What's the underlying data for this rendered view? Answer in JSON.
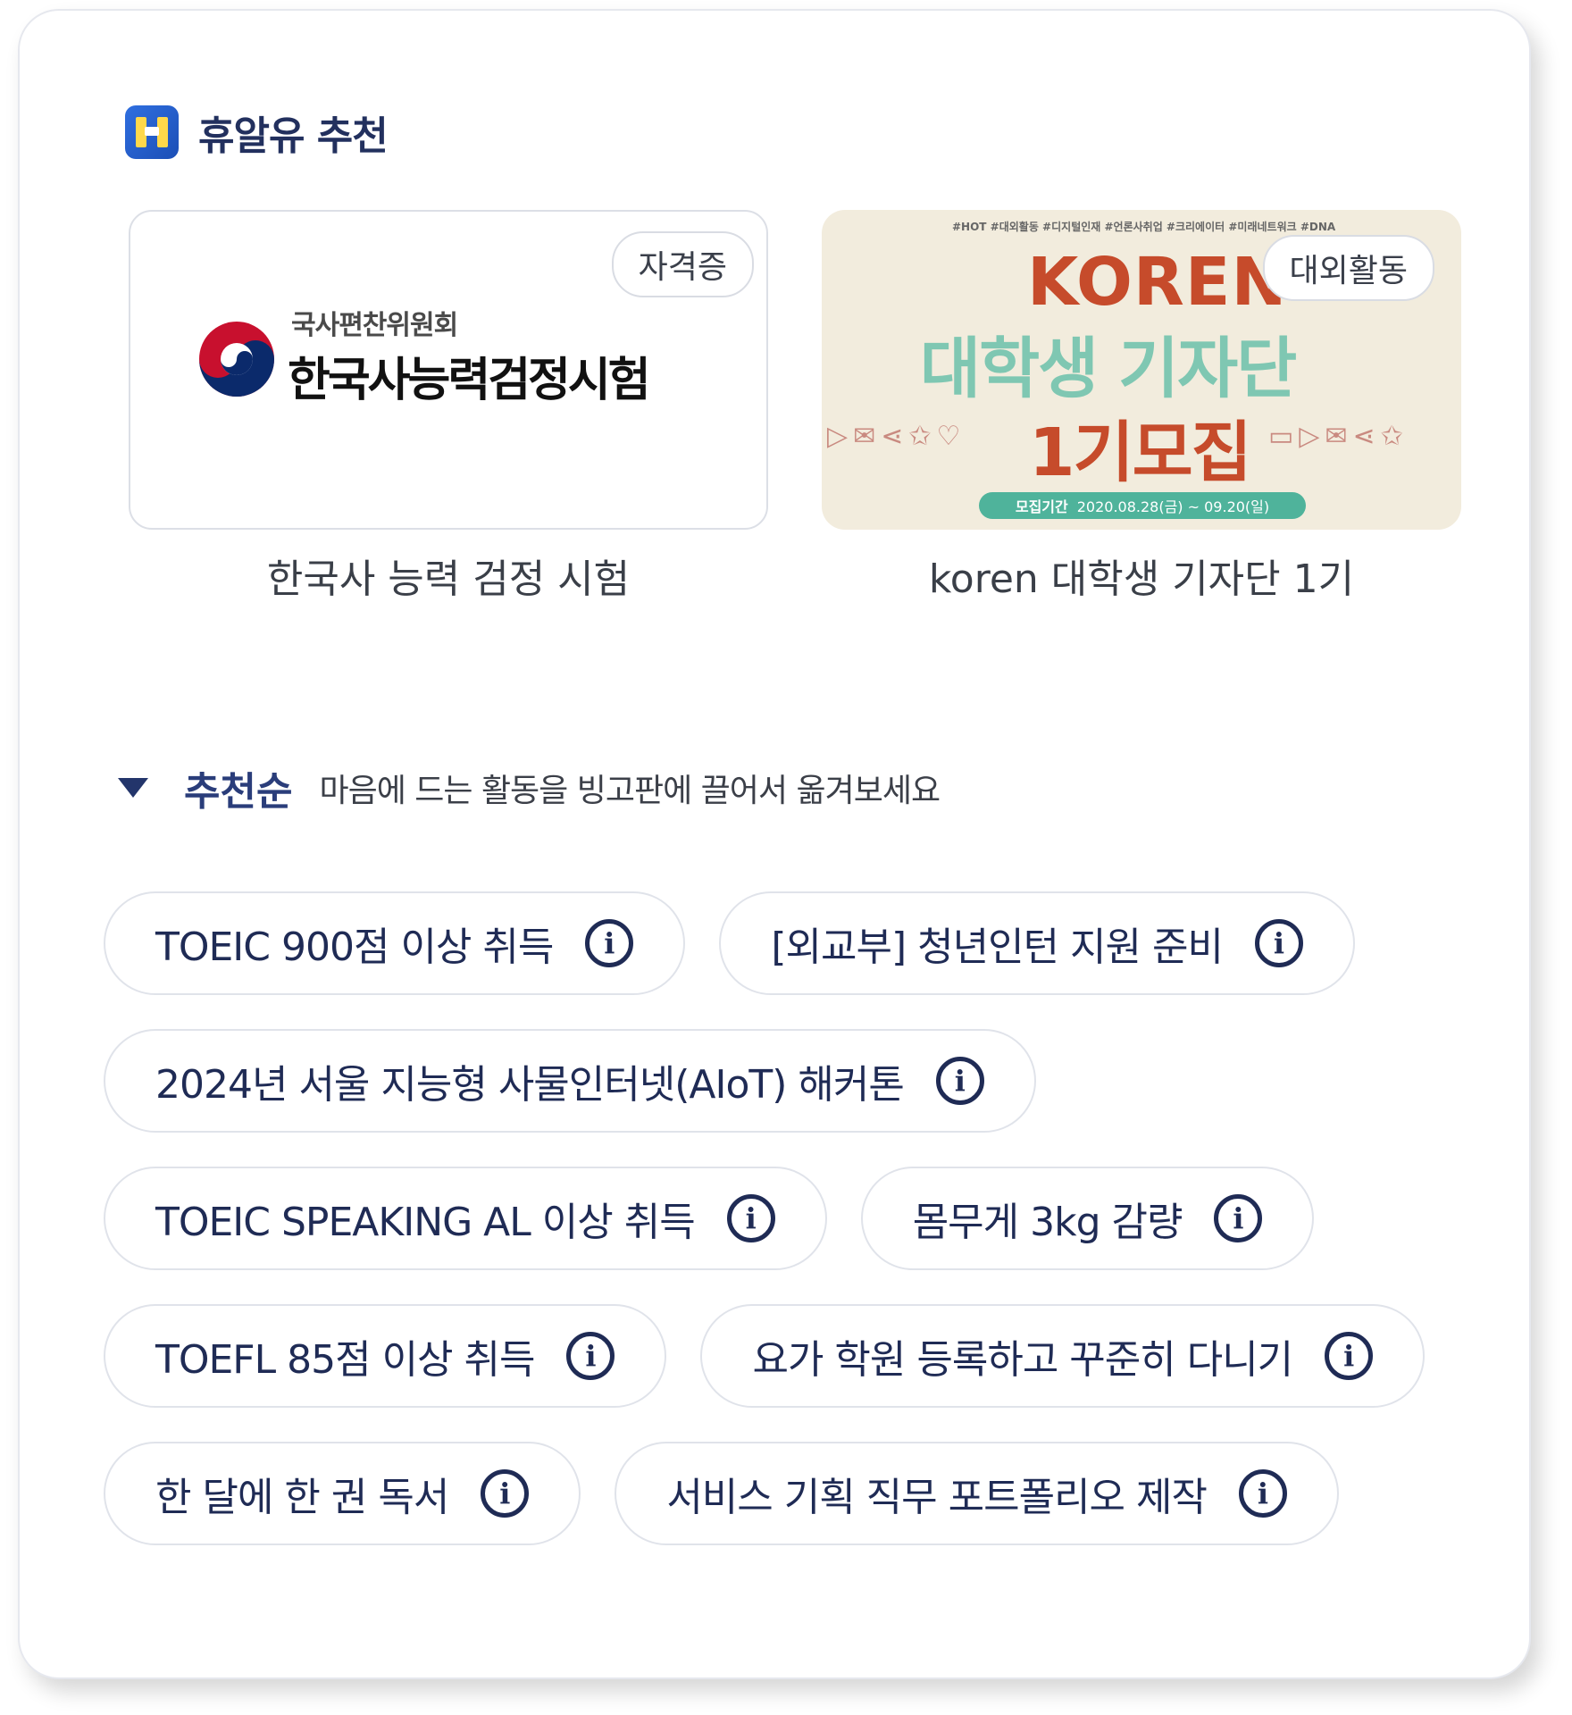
{
  "header": {
    "title": "휴알유 추천",
    "logo_icon": "huryou-logo-icon"
  },
  "recommendations": [
    {
      "badge": "자격증",
      "caption": "한국사 능력 검정 시험",
      "image_text": {
        "org": "국사편찬위원회",
        "name": "한국사능력검정시험"
      }
    },
    {
      "badge": "대외활동",
      "caption": "koren 대학생 기자단 1기",
      "image_text": {
        "tags": "#HOT #대외활동 #디지털인재 #언론사취업 #크리에이터 #미래네트워크 #DNA",
        "line1": "KOREN",
        "line2": "대학생 기자단",
        "line3": "1기모집",
        "period_label": "모집기간",
        "period": "2020.08.28(금) ~ 09.20(일)"
      }
    }
  ],
  "sort": {
    "label": "추천순",
    "hint": "마음에 드는 활동을 빙고판에 끌어서 옮겨보세요"
  },
  "chips": [
    [
      "TOEIC 900점 이상 취득",
      "[외교부] 청년인턴 지원 준비"
    ],
    [
      "2024년 서울 지능형 사물인터넷(AIoT) 해커톤"
    ],
    [
      "TOEIC SPEAKING AL 이상 취득",
      "몸무게 3kg 감량"
    ],
    [
      "TOEFL 85점 이상 취득",
      "요가 학원 등록하고 꾸준히 다니기"
    ],
    [
      "한 달에 한 권 독서",
      "서비스 기획 직무 포트폴리오 제작"
    ]
  ],
  "info_icon_glyph": "i",
  "colors": {
    "navy": "#1f2b55",
    "accent": "#2a3d7a",
    "chip_border": "#e0e3ea"
  }
}
